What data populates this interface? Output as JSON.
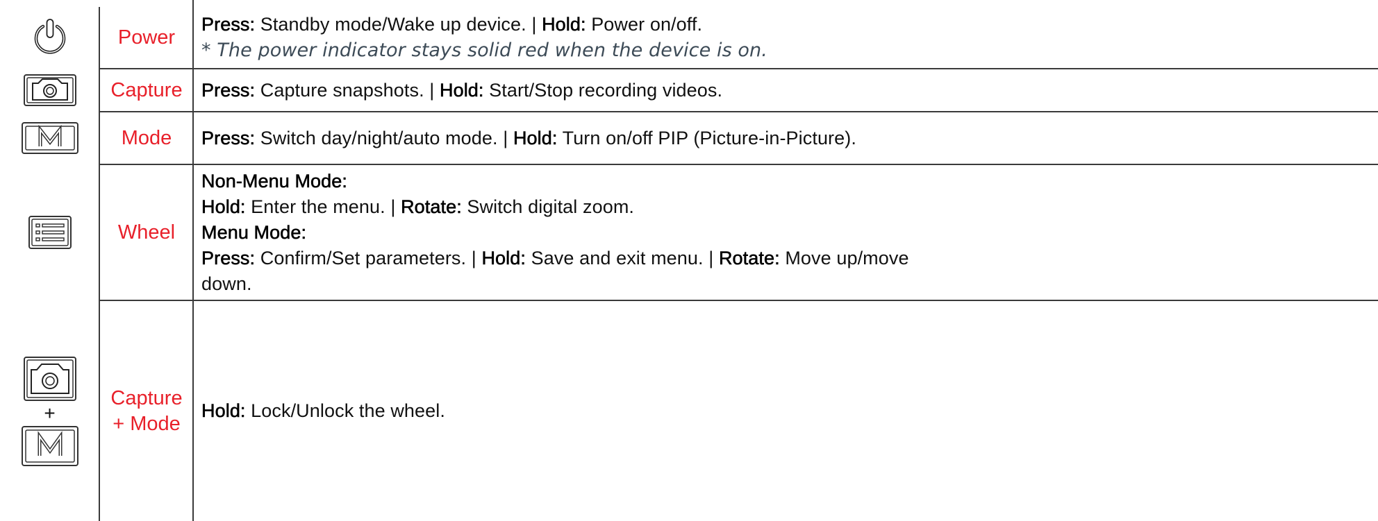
{
  "rows": [
    {
      "icon": "power-icon",
      "button": "Power",
      "lines": [
        {
          "k1": "Press:",
          "t1": " Standby mode/Wake up device. | ",
          "k2": "Hold:",
          "t2": " Power on/off."
        }
      ],
      "note": "* The power indicator stays solid red when the device is on."
    },
    {
      "icon": "camera-icon",
      "button": "Capture",
      "lines": [
        {
          "k1": "Press:",
          "t1": " Capture snapshots. | ",
          "k2": "Hold:",
          "t2": " Start/Stop recording videos."
        }
      ]
    },
    {
      "icon": "mode-m-icon",
      "button": "Mode",
      "lines": [
        {
          "k1": "Press:",
          "t1": " Switch day/night/auto mode. | ",
          "k2": "Hold:",
          "t2": " Turn on/off PIP (Picture-in-Picture)."
        }
      ]
    },
    {
      "icon": "menu-wheel-icon",
      "button": "Wheel",
      "heading1": "Non-Menu Mode:",
      "line1": {
        "k1": "Hold:",
        "t1": " Enter the menu. | ",
        "k2": "Rotate:",
        "t2": " Switch digital zoom."
      },
      "heading2": "Menu Mode:",
      "line2": {
        "k1": "Press:",
        "t1": " Confirm/Set parameters. | ",
        "k2": "Hold:",
        "t2": " Save and exit menu. | ",
        "k3": "Rotate:",
        "t3": " Move up/move"
      },
      "line2_cont": "down."
    },
    {
      "icon": "camera-plus-mode-icon",
      "button_line1": "Capture",
      "button_line2": "+ Mode",
      "plus": "+",
      "line": {
        "k1": "Hold:",
        "t1": " Lock/Unlock the wheel."
      }
    }
  ],
  "colors": {
    "accent": "#e8202a",
    "note": "#3d4b57",
    "border": "#3a3a3a"
  }
}
